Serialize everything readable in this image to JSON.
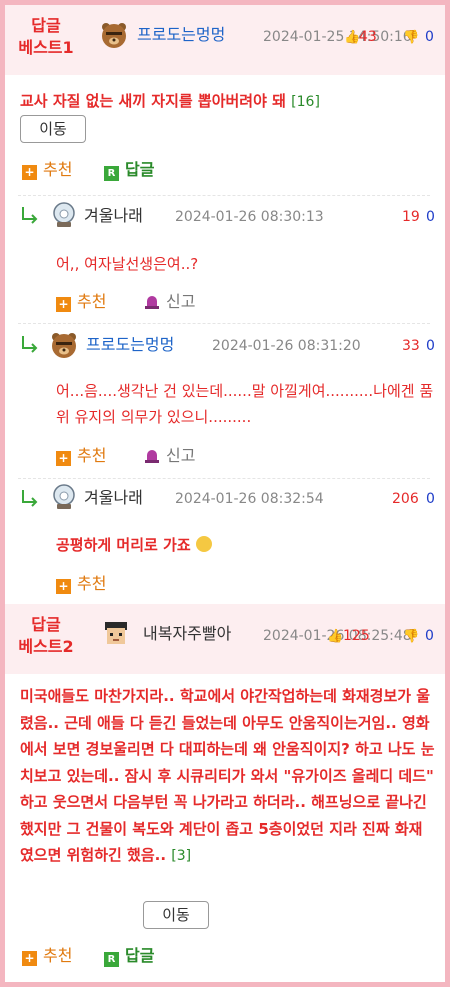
{
  "best1": {
    "label": "답글\n베스트1",
    "author": "프로도는멍멍",
    "date": "2024-01-25 14:50:16",
    "up": "43",
    "down": "0",
    "text": "교사 자질 없는 새끼 자지를 뽑아버려야 돼",
    "count": "[16]",
    "move": "이동",
    "recommend": "추천",
    "reply": "답글"
  },
  "replies": [
    {
      "author": "겨울나래",
      "date": "2024-01-26 08:30:13",
      "up": "19",
      "down": "0",
      "text": "어,, 여자날선생은여..?",
      "recommend": "추천",
      "report": "신고"
    },
    {
      "author": "프로도는멍멍",
      "date": "2024-01-26 08:31:20",
      "up": "33",
      "down": "0",
      "text": "어...음....생각난 건 있는데......말 아낄게여..........나에겐 품위 유지의 의무가 있으니.........",
      "recommend": "추천",
      "report": "신고"
    },
    {
      "author": "겨울나래",
      "date": "2024-01-26 08:32:54",
      "up": "206",
      "down": "0",
      "text": "공평하게 머리로 가죠",
      "recommend": "추천"
    }
  ],
  "best2": {
    "label": "답글\n베스트2",
    "author": "내복자주빨아",
    "date": "2024-01-26 08:25:48",
    "up": "125",
    "down": "0",
    "text": "미국애들도 마찬가지라.. 학교에서 야간작업하는데 화재경보가 울렸음.. 근데 애들 다 듣긴 들었는데 아무도 안움직이는거임.. 영화에서 보면 경보울리면 다 대피하는데 왜 안움직이지? 하고 나도 눈치보고 있는데.. 잠시 후 시큐리티가 와서 \"유가이즈 올레디 데드\" 하고 웃으면서 다음부턴 꼭 나가라고 하더라.. 해프닝으로 끝나긴 했지만 그 건물이 복도와 계단이 좁고 5층이었던 지라 진짜 화재였으면 위험하긴 했음..",
    "count": "[3]",
    "move": "이동",
    "recommend": "추천",
    "reply": "답글"
  },
  "colors": {
    "accent_red": "#e52a2a",
    "border_pink": "#f4b6c0",
    "vote_blue": "#1e3cc8",
    "recommend_orange": "#f08a10",
    "reply_green": "#3aa83a"
  }
}
